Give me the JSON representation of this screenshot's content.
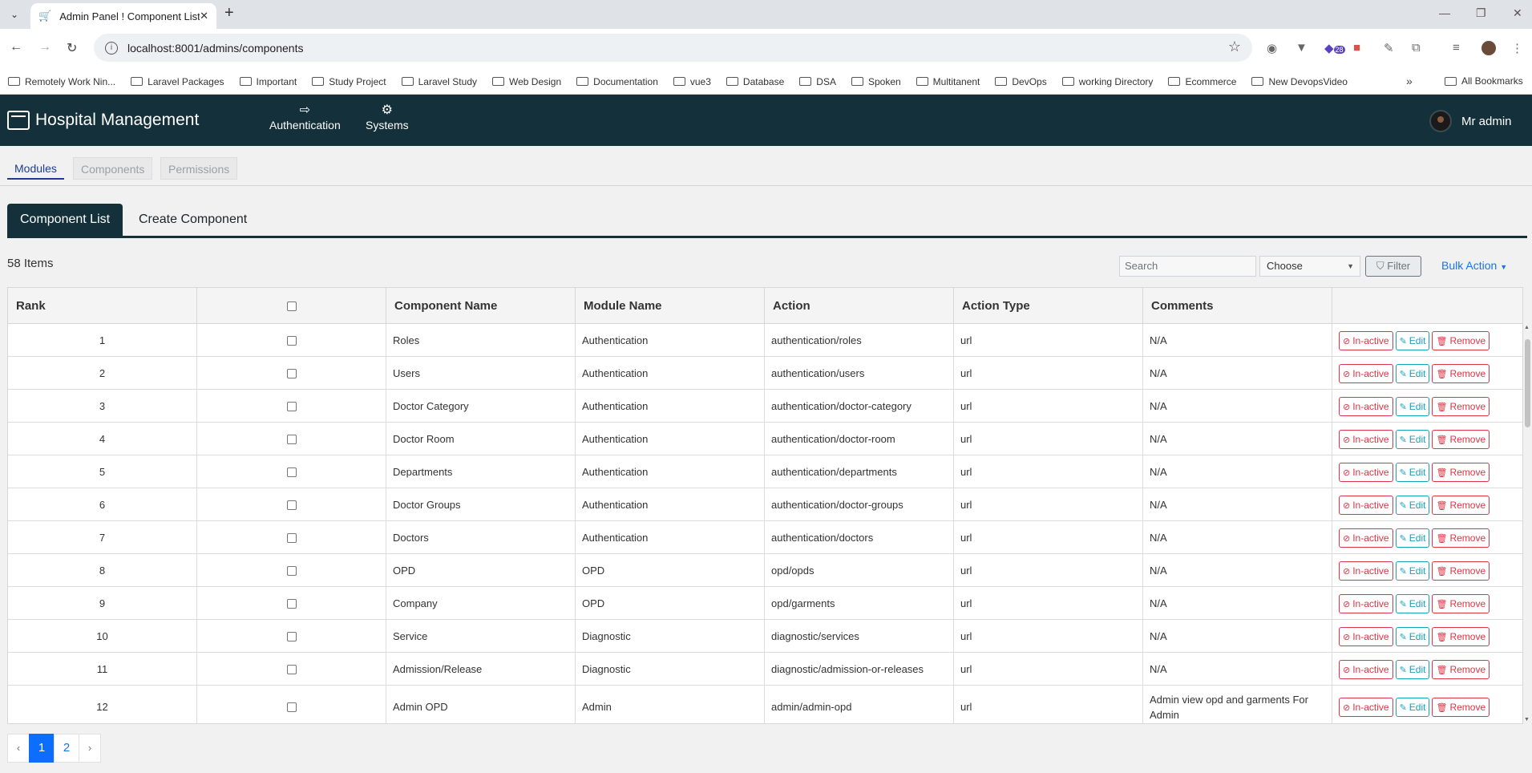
{
  "browser": {
    "tab_title": "Admin Panel ! Component List",
    "url": "localhost:8001/admins/components",
    "extension_badge": "28",
    "bookmarks": [
      "Remotely Work Nin...",
      "Laravel Packages",
      "Important",
      "Study Project",
      "Laravel Study",
      "Web Design",
      "Documentation",
      "vue3",
      "Database",
      "DSA",
      "Spoken",
      "Multitanent",
      "DevOps",
      "working Directory",
      "Ecommerce",
      "New DevopsVideo"
    ],
    "all_bookmarks": "All Bookmarks"
  },
  "header": {
    "brand": "Hospital Management",
    "menu": [
      {
        "label": "Authentication",
        "icon": "sign-out-icon"
      },
      {
        "label": "Systems",
        "icon": "users-cog-icon"
      }
    ],
    "user": "Mr admin"
  },
  "subnav": {
    "tabs": [
      "Modules",
      "Components",
      "Permissions"
    ]
  },
  "main_tabs": [
    "Component List",
    "Create Component"
  ],
  "toolbar": {
    "items_count": "58 Items",
    "search_placeholder": "Search",
    "select_value": "Choose",
    "filter_label": "Filter",
    "bulk_label": "Bulk Action"
  },
  "table": {
    "headers": [
      "Rank",
      "",
      "Component Name",
      "Module Name",
      "Action",
      "Action Type",
      "Comments",
      ""
    ],
    "rows": [
      {
        "rank": "1",
        "name": "Roles",
        "module": "Authentication",
        "action": "authentication/roles",
        "type": "url",
        "comment": "N/A"
      },
      {
        "rank": "2",
        "name": "Users",
        "module": "Authentication",
        "action": "authentication/users",
        "type": "url",
        "comment": "N/A"
      },
      {
        "rank": "3",
        "name": "Doctor Category",
        "module": "Authentication",
        "action": "authentication/doctor-category",
        "type": "url",
        "comment": "N/A"
      },
      {
        "rank": "4",
        "name": "Doctor Room",
        "module": "Authentication",
        "action": "authentication/doctor-room",
        "type": "url",
        "comment": "N/A"
      },
      {
        "rank": "5",
        "name": "Departments",
        "module": "Authentication",
        "action": "authentication/departments",
        "type": "url",
        "comment": "N/A"
      },
      {
        "rank": "6",
        "name": "Doctor Groups",
        "module": "Authentication",
        "action": "authentication/doctor-groups",
        "type": "url",
        "comment": "N/A"
      },
      {
        "rank": "7",
        "name": "Doctors",
        "module": "Authentication",
        "action": "authentication/doctors",
        "type": "url",
        "comment": "N/A"
      },
      {
        "rank": "8",
        "name": "OPD",
        "module": "OPD",
        "action": "opd/opds",
        "type": "url",
        "comment": "N/A"
      },
      {
        "rank": "9",
        "name": "Company",
        "module": "OPD",
        "action": "opd/garments",
        "type": "url",
        "comment": "N/A"
      },
      {
        "rank": "10",
        "name": "Service",
        "module": "Diagnostic",
        "action": "diagnostic/services",
        "type": "url",
        "comment": "N/A"
      },
      {
        "rank": "11",
        "name": "Admission/Release",
        "module": "Diagnostic",
        "action": "diagnostic/admission-or-releases",
        "type": "url",
        "comment": "N/A"
      },
      {
        "rank": "12",
        "name": "Admin OPD",
        "module": "Admin",
        "action": "admin/admin-opd",
        "type": "url",
        "comment": "Admin view opd and garments For Admin"
      }
    ],
    "buttons": {
      "inactive": "In-active",
      "edit": "Edit",
      "remove": "Remove"
    }
  },
  "pagination": {
    "prev": "‹",
    "pages": [
      "1",
      "2"
    ],
    "next": "›",
    "current": "1"
  },
  "colors": {
    "header_bg": "#14303a",
    "primary": "#0d6efd",
    "danger": "#dc3545",
    "info": "#17a2b8"
  }
}
